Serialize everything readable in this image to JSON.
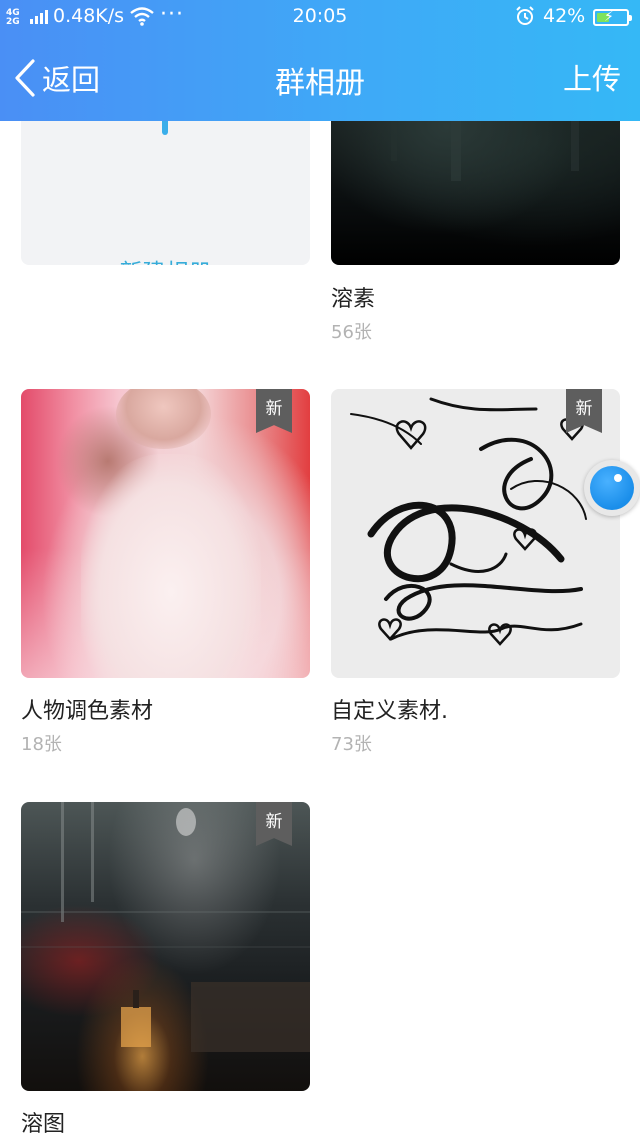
{
  "status_bar": {
    "network": "4G\n2G",
    "speed": "0.48K/s",
    "more": "···",
    "time": "20:05",
    "battery_percent": "42%",
    "battery_level": 0.42
  },
  "header": {
    "back_label": "返回",
    "title": "群相册",
    "upload_label": "上传"
  },
  "new_album": {
    "label": "新建相册"
  },
  "badge_new": "新",
  "albums": [
    {
      "name": "溶素",
      "count": "56张",
      "is_new": false
    },
    {
      "name": "人物调色素材",
      "count": "18张",
      "is_new": true
    },
    {
      "name": "自定义素材.",
      "count": "73张",
      "is_new": true
    },
    {
      "name": "溶图",
      "count": "",
      "is_new": true
    }
  ],
  "colors": {
    "header_start": "#4a8ff5",
    "header_end": "#35b8f6",
    "new_album_text": "#36acd9",
    "count_text": "#b3b3b3"
  }
}
